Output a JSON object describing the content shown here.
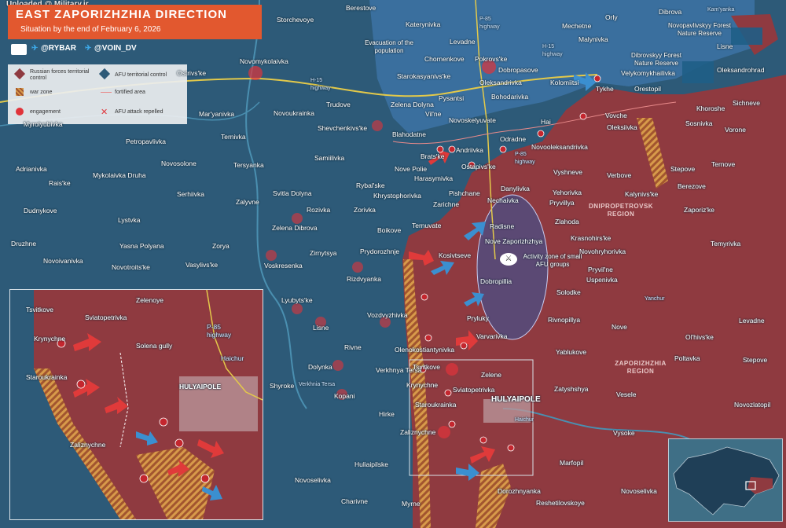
{
  "upload_watermark": "Uploaded @ Military.ir",
  "title": "EAST ZAPORIZHZHIA DIRECTION",
  "subtitle": "Situation by the end of February 6, 2026",
  "social": {
    "handle_rybar": "@RYBAR",
    "handle_voin": "@VOIN_DV"
  },
  "colors": {
    "russian_control": "#8f3a40",
    "afu_control": "#2d5a78",
    "afu_north": "#3a6f9e",
    "war_zone": "#d79a4a",
    "engagement": "#e0333a",
    "attack_arrow": "#e03a3a",
    "afu_arrow": "#3b8fd0"
  },
  "legend": {
    "russian": "Russian forces territorial control",
    "afu": "AFU territorial control",
    "war_zone": "war zone",
    "fortified": "fortified area",
    "engagement": "engagement",
    "repelled": "AFU attack repelled"
  },
  "regions": {
    "dnipro": "DNIPROPETROVSK REGION",
    "zaporizhzhia": "ZAPORIZHZHIA REGION"
  },
  "roads": {
    "p85_a": "P-85 highway",
    "h15_a": "H-15 highway",
    "h15_b": "H-15 highway",
    "p85_b": "P-85 highway",
    "p85_inset": "P-85 highway"
  },
  "annotations": {
    "evacuation": "Evacuation of the population",
    "activity": "Activity zone of small AFU groups",
    "forest1": "Novopavlivskyy Forest Nature Reserve",
    "forest2": "Dibrovskyy Forest Nature Reserve",
    "solena": "Solena gully",
    "haichur": "Haichur",
    "yanchur": "Yanchur",
    "verkhnia_tersa_river": "Verkhnia Tersa",
    "kamianka": "Kam'yanka"
  },
  "places": {
    "berestove": "Berestove",
    "storchevoye": "Storchevoye",
    "katerynivka": "Katerynivka",
    "levadne": "Levadne",
    "chornenkove": "Chornenkove",
    "pokrovske": "Pokrovs'ke",
    "dobropasove": "Dobropasove",
    "orly": "Orly",
    "mechetne": "Mechetne",
    "malynivka": "Malynivka",
    "dibrova": "Dibrova",
    "lisne_ne": "Lisne",
    "velykomykhailivka": "Velykomykhailivka",
    "oleksandrohrad": "Oleksandrohrad",
    "novomykolaivka": "Novomykolaivka",
    "ostrivske": "Ostrivs'ke",
    "starokasyanivske": "Starokasyanivs'ke",
    "oleksandrivka": "Oleksandrivka",
    "kolomiitsi": "Kolomiitsi",
    "tykhe": "Tykhe",
    "orestopil": "Orestopil",
    "khoroshe": "Khoroshe",
    "sichneve": "Sichneve",
    "trudove": "Trudove",
    "zelena_dolyna": "Zelena Dolyna",
    "pysantsi": "Pysantsi",
    "bohodarivka": "Bohodarivka",
    "vovche": "Vovche",
    "maryanivka": "Mar'yanivka",
    "novoukrainka": "Novoukrainka",
    "vilne": "Vil'ne",
    "novoskelyuvate": "Novoskelyuvate",
    "hai": "Hai",
    "oleksiivka": "Oleksiivka",
    "sosnivka": "Sosnivka",
    "vorone": "Vorone",
    "myrolyubivka": "Myrolyubivka",
    "ternivka": "Ternivka",
    "shevchenkivske": "Shevchenkivs'ke",
    "blahodatne": "Blahodatne",
    "odradne": "Odradne",
    "novooleksandrivka": "Novooleksandrivka",
    "petropavlivka": "Petropavlivka",
    "samiilivka": "Samiilivka",
    "andriivka": "Andriivka",
    "bratske": "Brats'ke",
    "ostapivske": "Ostapivs'ke",
    "adrianivka": "Adrianivka",
    "novosolone": "Novosolone",
    "tersyanka": "Tersyanka",
    "vyshneve": "Vyshneve",
    "verbove": "Verbove",
    "stepove_n": "Stepove",
    "ternove": "Ternove",
    "raiske": "Rais'ke",
    "mykolaivka_druha": "Mykolaivka Druha",
    "rybalske": "Rybal'ske",
    "nove_polie": "Nove Polie",
    "harasymivka": "Harasymivka",
    "danylivka": "Danylivka",
    "yehorivka": "Yehorivka",
    "kalynivske": "Kalynivs'ke",
    "berezove": "Berezove",
    "sernivka": "Serhiivka",
    "svitla_dolyna": "Svitla Dolyna",
    "khrystoforivka": "Khrystophorivka",
    "pishchane": "Pishchane",
    "zarichne": "Zarichne",
    "nechaivka": "Nechaivka",
    "pryvillya": "Pryvillya",
    "dudnykove": "Dudnykove",
    "zalyvne": "Zalyvne",
    "rozivka": "Rozivka",
    "zorivka": "Zorivka",
    "zhovtneve": "Zhovtneve",
    "zaporizke": "Zaporiz'ke",
    "lystvka": "Lystvka",
    "zelena_dibrova": "Zelena Dibrova",
    "boikove": "Boikove",
    "ternuvate": "Ternuvate",
    "radisne": "Radisne",
    "zlahoda": "Zlahoda",
    "krasnohirske": "Krasnohirs'ke",
    "temyrivka": "Temyrivka",
    "druzhne": "Druzhne",
    "yasna_polyana": "Yasna Polyana",
    "zorya": "Zorya",
    "zirnytsya": "Zirnytsya",
    "prydorozhnje": "Prydorozhnje",
    "kosivtseve": "Kosivtseve",
    "nove_zaporizhzhya": "Nove Zaporizhzhya",
    "novohryhorivka": "Novohryhorivka",
    "novoivanivka": "Novoivanivka",
    "novotroitske": "Novotroits'ke",
    "vasylivske": "Vasylivs'ke",
    "voskresenka": "Voskresenka",
    "pryvilne": "Pryvil'ne",
    "rizdvyanka": "Rizdvyanka",
    "dobropillia": "Dobropillia",
    "uspenivka": "Uspenivka",
    "lyubytske": "Lyubyts'ke",
    "solodke": "Solodke",
    "vozdvyzhivka": "Vozdvyzhivka",
    "pryluky": "Pryluky",
    "rivnopillya": "Rivnopillya",
    "lisne": "Lisne",
    "nove": "Nove",
    "levadne_e": "Levadne",
    "varvarivka": "Varvarivka",
    "rivne": "Rivne",
    "olenokostiantynivka": "Olenokostiantynivka",
    "olhivske": "Ol'hivs'ke",
    "yablukove": "Yablukove",
    "dolynka": "Dolynka",
    "verkhnya_tersa": "Verkhnya Tersa",
    "tsvitkove": "Tsvitkove",
    "zelene": "Zelene",
    "poltavka": "Poltavka",
    "stepove_e": "Stepove",
    "shyroke": "Shyroke",
    "krynychne": "Krynychne",
    "sviatopetrivka": "Sviatopetrivka",
    "zatyshshya": "Zatyshshya",
    "kopani": "Kopani",
    "vesele": "Vesele",
    "starouspenivka": "Staroukrainka",
    "hulyaipole": "HULYAIPOLE",
    "novozlatopil": "Novozlatopil",
    "hirke": "Hirke",
    "zaliznychne": "Zaliznychne",
    "vysoke": "Vysoke",
    "marfopil": "Marfopil",
    "huliaipilske": "Huliaipilske",
    "novoselivka_w": "Novoselivka",
    "dorozhnyanka": "Dorozhnyanka",
    "novoselivka_e": "Novoselivka",
    "charivne": "Charivne",
    "myrne": "Myrne",
    "reshetilovskoye": "Reshetilovskoye"
  },
  "inset": {
    "tsvitkove": "Tsvitkove",
    "zelenoye": "Zelenoye",
    "sviatopetrivka": "Sviatopetrivka",
    "krynychne": "Krynychne",
    "staroukrainka": "Staroukrainka",
    "hulyaipole": "HULYAIPOLE",
    "zaliznychne": "Zaliznychne"
  }
}
